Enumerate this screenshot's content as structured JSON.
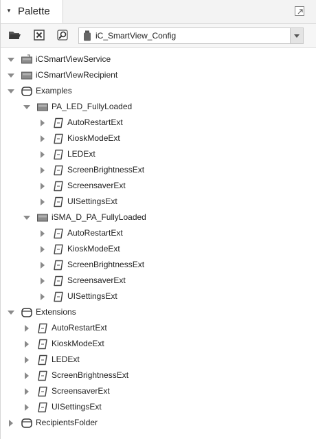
{
  "panel": {
    "title": "Palette",
    "collapse_icon": "caret-down-icon",
    "maximize_icon": "maximize-icon"
  },
  "toolbar": {
    "open_icon": "folder-open-icon",
    "close_icon": "close-box-icon",
    "find_icon": "find-icon",
    "module_value": "iC_SmartView_Config",
    "module_icon": "jar-icon"
  },
  "tree": [
    {
      "label": "iCSmartViewService",
      "depth": 0,
      "state": "open",
      "icon": "service"
    },
    {
      "label": "iCSmartViewRecipient",
      "depth": 0,
      "state": "open",
      "icon": "device"
    },
    {
      "label": "Examples",
      "depth": 0,
      "state": "open",
      "icon": "folder"
    },
    {
      "label": "PA_LED_FullyLoaded",
      "depth": 1,
      "state": "open",
      "icon": "device"
    },
    {
      "label": "AutoRestartExt",
      "depth": 2,
      "state": "closed",
      "icon": "ext"
    },
    {
      "label": "KioskModeExt",
      "depth": 2,
      "state": "closed",
      "icon": "ext"
    },
    {
      "label": "LEDExt",
      "depth": 2,
      "state": "closed",
      "icon": "ext"
    },
    {
      "label": "ScreenBrightnessExt",
      "depth": 2,
      "state": "closed",
      "icon": "ext"
    },
    {
      "label": "ScreensaverExt",
      "depth": 2,
      "state": "closed",
      "icon": "ext"
    },
    {
      "label": "UISettingsExt",
      "depth": 2,
      "state": "closed",
      "icon": "ext"
    },
    {
      "label": "iSMA_D_PA_FullyLoaded",
      "depth": 1,
      "state": "open",
      "icon": "device"
    },
    {
      "label": "AutoRestartExt",
      "depth": 2,
      "state": "closed",
      "icon": "ext"
    },
    {
      "label": "KioskModeExt",
      "depth": 2,
      "state": "closed",
      "icon": "ext"
    },
    {
      "label": "ScreenBrightnessExt",
      "depth": 2,
      "state": "closed",
      "icon": "ext"
    },
    {
      "label": "ScreensaverExt",
      "depth": 2,
      "state": "closed",
      "icon": "ext"
    },
    {
      "label": "UISettingsExt",
      "depth": 2,
      "state": "closed",
      "icon": "ext"
    },
    {
      "label": "Extensions",
      "depth": 0,
      "state": "open",
      "icon": "folder"
    },
    {
      "label": "AutoRestartExt",
      "depth": 1,
      "state": "closed",
      "icon": "ext"
    },
    {
      "label": "KioskModeExt",
      "depth": 1,
      "state": "closed",
      "icon": "ext"
    },
    {
      "label": "LEDExt",
      "depth": 1,
      "state": "closed",
      "icon": "ext"
    },
    {
      "label": "ScreenBrightnessExt",
      "depth": 1,
      "state": "closed",
      "icon": "ext"
    },
    {
      "label": "ScreensaverExt",
      "depth": 1,
      "state": "closed",
      "icon": "ext"
    },
    {
      "label": "UISettingsExt",
      "depth": 1,
      "state": "closed",
      "icon": "ext"
    },
    {
      "label": "RecipientsFolder",
      "depth": 0,
      "state": "closed",
      "icon": "folder"
    }
  ]
}
